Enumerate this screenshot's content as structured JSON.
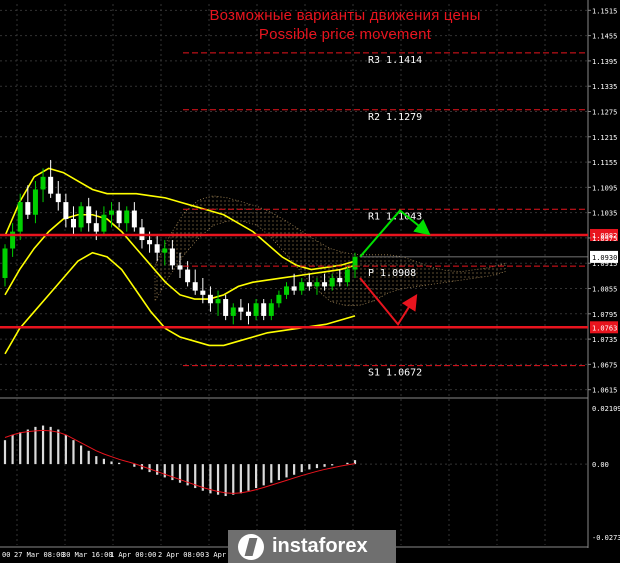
{
  "header": {
    "title_ru": "Возможные варианты движения цены",
    "title_en": "Possible price movement"
  },
  "watermark": {
    "text": "instaforex",
    "icon": "instaforex-logo-icon"
  },
  "colors": {
    "background": "#000000",
    "grid": "#333333",
    "title": "#e8141e",
    "level_line": "#e8141e",
    "bullish_candle": "#00d000",
    "bearish_candle": "#ffffff",
    "bollinger": "#ffff00",
    "ichimoku_cloud": "#c8a46a",
    "forecast_arrow_up": "#00e000",
    "forecast_arrow_down": "#e8141e",
    "macd_histogram": "#dcdcdc",
    "macd_signal": "#e8141e"
  },
  "chart_data": {
    "type": "candlestick",
    "instrument": "EURUSD",
    "price_axis_ticks": [
      "1.1515",
      "1.1455",
      "1.1395",
      "1.1335",
      "1.1275",
      "1.1215",
      "1.1155",
      "1.1095",
      "1.1035",
      "1.0975",
      "1.0915",
      "1.0855",
      "1.0795",
      "1.0735",
      "1.0675",
      "1.0615"
    ],
    "ylim": [
      1.06,
      1.153
    ],
    "time_axis_ticks": [
      "00",
      "27 Mar 08:00",
      "30 Mar 16:00",
      "1 Apr 00:00",
      "2 Apr 08:00",
      "3 Apr"
    ],
    "current_price": "1.0930",
    "levels": [
      {
        "name": "R3",
        "label": "R3 1.1414",
        "value": 1.1414,
        "style": "dashed"
      },
      {
        "name": "R2",
        "label": "R2 1.1279",
        "value": 1.1279,
        "style": "dashed"
      },
      {
        "name": "R1",
        "label": "R1 1.1043",
        "value": 1.1043,
        "style": "dashed"
      },
      {
        "name": "P",
        "label": "P 1.0908",
        "value": 1.0908,
        "style": "dashed"
      },
      {
        "name": "S1",
        "label": "S1 1.0672",
        "value": 1.0672,
        "style": "dashed"
      }
    ],
    "key_lines": [
      {
        "label": "1.0982",
        "value": 1.0982
      },
      {
        "label": "1.0763",
        "value": 1.0763
      }
    ],
    "candles": [
      {
        "o": 1.088,
        "h": 1.096,
        "l": 1.086,
        "c": 1.095
      },
      {
        "o": 1.095,
        "h": 1.101,
        "l": 1.093,
        "c": 1.099
      },
      {
        "o": 1.099,
        "h": 1.108,
        "l": 1.097,
        "c": 1.106
      },
      {
        "o": 1.106,
        "h": 1.11,
        "l": 1.102,
        "c": 1.103
      },
      {
        "o": 1.103,
        "h": 1.111,
        "l": 1.101,
        "c": 1.109
      },
      {
        "o": 1.109,
        "h": 1.114,
        "l": 1.106,
        "c": 1.112
      },
      {
        "o": 1.112,
        "h": 1.116,
        "l": 1.107,
        "c": 1.108
      },
      {
        "o": 1.108,
        "h": 1.111,
        "l": 1.104,
        "c": 1.106
      },
      {
        "o": 1.106,
        "h": 1.108,
        "l": 1.1,
        "c": 1.102
      },
      {
        "o": 1.102,
        "h": 1.105,
        "l": 1.098,
        "c": 1.1
      },
      {
        "o": 1.1,
        "h": 1.106,
        "l": 1.099,
        "c": 1.105
      },
      {
        "o": 1.105,
        "h": 1.107,
        "l": 1.099,
        "c": 1.101
      },
      {
        "o": 1.101,
        "h": 1.104,
        "l": 1.097,
        "c": 1.099
      },
      {
        "o": 1.099,
        "h": 1.105,
        "l": 1.098,
        "c": 1.103
      },
      {
        "o": 1.103,
        "h": 1.106,
        "l": 1.1,
        "c": 1.104
      },
      {
        "o": 1.104,
        "h": 1.106,
        "l": 1.1,
        "c": 1.101
      },
      {
        "o": 1.101,
        "h": 1.105,
        "l": 1.099,
        "c": 1.104
      },
      {
        "o": 1.104,
        "h": 1.106,
        "l": 1.099,
        "c": 1.1
      },
      {
        "o": 1.1,
        "h": 1.102,
        "l": 1.095,
        "c": 1.097
      },
      {
        "o": 1.097,
        "h": 1.099,
        "l": 1.094,
        "c": 1.096
      },
      {
        "o": 1.096,
        "h": 1.098,
        "l": 1.092,
        "c": 1.094
      },
      {
        "o": 1.094,
        "h": 1.097,
        "l": 1.091,
        "c": 1.095
      },
      {
        "o": 1.095,
        "h": 1.097,
        "l": 1.09,
        "c": 1.091
      },
      {
        "o": 1.091,
        "h": 1.094,
        "l": 1.088,
        "c": 1.09
      },
      {
        "o": 1.09,
        "h": 1.092,
        "l": 1.086,
        "c": 1.087
      },
      {
        "o": 1.087,
        "h": 1.09,
        "l": 1.084,
        "c": 1.085
      },
      {
        "o": 1.085,
        "h": 1.088,
        "l": 1.082,
        "c": 1.084
      },
      {
        "o": 1.084,
        "h": 1.086,
        "l": 1.08,
        "c": 1.082
      },
      {
        "o": 1.082,
        "h": 1.085,
        "l": 1.079,
        "c": 1.083
      },
      {
        "o": 1.083,
        "h": 1.084,
        "l": 1.078,
        "c": 1.079
      },
      {
        "o": 1.079,
        "h": 1.082,
        "l": 1.077,
        "c": 1.081
      },
      {
        "o": 1.081,
        "h": 1.083,
        "l": 1.078,
        "c": 1.08
      },
      {
        "o": 1.08,
        "h": 1.082,
        "l": 1.077,
        "c": 1.079
      },
      {
        "o": 1.079,
        "h": 1.083,
        "l": 1.078,
        "c": 1.082
      },
      {
        "o": 1.082,
        "h": 1.083,
        "l": 1.078,
        "c": 1.079
      },
      {
        "o": 1.079,
        "h": 1.083,
        "l": 1.078,
        "c": 1.082
      },
      {
        "o": 1.082,
        "h": 1.085,
        "l": 1.081,
        "c": 1.084
      },
      {
        "o": 1.084,
        "h": 1.087,
        "l": 1.083,
        "c": 1.086
      },
      {
        "o": 1.086,
        "h": 1.089,
        "l": 1.084,
        "c": 1.085
      },
      {
        "o": 1.085,
        "h": 1.088,
        "l": 1.084,
        "c": 1.087
      },
      {
        "o": 1.087,
        "h": 1.089,
        "l": 1.085,
        "c": 1.086
      },
      {
        "o": 1.086,
        "h": 1.088,
        "l": 1.084,
        "c": 1.087
      },
      {
        "o": 1.087,
        "h": 1.089,
        "l": 1.085,
        "c": 1.086
      },
      {
        "o": 1.086,
        "h": 1.089,
        "l": 1.085,
        "c": 1.088
      },
      {
        "o": 1.088,
        "h": 1.09,
        "l": 1.086,
        "c": 1.087
      },
      {
        "o": 1.087,
        "h": 1.091,
        "l": 1.086,
        "c": 1.09
      },
      {
        "o": 1.09,
        "h": 1.094,
        "l": 1.088,
        "c": 1.093
      }
    ],
    "bollinger_upper": [
      1.098,
      1.106,
      1.112,
      1.114,
      1.113,
      1.111,
      1.109,
      1.108,
      1.108,
      1.108,
      1.1075,
      1.107,
      1.106,
      1.105,
      1.104,
      1.103,
      1.101,
      1.099,
      1.096,
      1.093,
      1.091,
      1.09,
      1.0905,
      1.091,
      1.092
    ],
    "bollinger_middle": [
      1.084,
      1.09,
      1.095,
      1.099,
      1.102,
      1.103,
      1.103,
      1.102,
      1.099,
      1.095,
      1.091,
      1.087,
      1.084,
      1.083,
      1.083,
      1.084,
      1.086,
      1.087,
      1.0875,
      1.088,
      1.0885,
      1.089,
      1.0895,
      1.09,
      1.091
    ],
    "bollinger_lower": [
      1.07,
      1.076,
      1.08,
      1.084,
      1.088,
      1.092,
      1.094,
      1.093,
      1.09,
      1.085,
      1.08,
      1.076,
      1.074,
      1.073,
      1.072,
      1.072,
      1.073,
      1.074,
      1.075,
      1.0755,
      1.076,
      1.0765,
      1.077,
      1.078,
      1.079
    ],
    "forecast": [
      {
        "direction": "up",
        "from": 1.093,
        "via": 1.104,
        "to": 1.099
      },
      {
        "direction": "down",
        "from": 1.088,
        "via": 1.077,
        "to": 1.083
      }
    ],
    "macd": {
      "axis_ticks": [
        "0.02109",
        "0.00",
        "-0.02739"
      ],
      "ylim": [
        -0.02739,
        0.02109
      ],
      "histogram": [
        0.009,
        0.011,
        0.012,
        0.013,
        0.014,
        0.0145,
        0.014,
        0.013,
        0.011,
        0.009,
        0.007,
        0.005,
        0.003,
        0.002,
        0.001,
        0.0005,
        0.0,
        -0.001,
        -0.002,
        -0.003,
        -0.004,
        -0.005,
        -0.006,
        -0.007,
        -0.008,
        -0.009,
        -0.01,
        -0.011,
        -0.0115,
        -0.012,
        -0.0115,
        -0.011,
        -0.01,
        -0.009,
        -0.008,
        -0.007,
        -0.006,
        -0.005,
        -0.004,
        -0.003,
        -0.002,
        -0.0015,
        -0.001,
        -0.0005,
        0.0,
        0.0005,
        0.0015
      ],
      "signal": [
        0.01,
        0.011,
        0.0118,
        0.0122,
        0.0125,
        0.0127,
        0.0125,
        0.012,
        0.011,
        0.0095,
        0.008,
        0.0065,
        0.005,
        0.0038,
        0.0028,
        0.0018,
        0.001,
        0.0002,
        -0.0008,
        -0.0018,
        -0.0028,
        -0.0038,
        -0.0048,
        -0.0058,
        -0.0068,
        -0.0078,
        -0.0088,
        -0.0096,
        -0.0103,
        -0.0108,
        -0.011,
        -0.0108,
        -0.0103,
        -0.0096,
        -0.0088,
        -0.0079,
        -0.007,
        -0.0061,
        -0.0052,
        -0.0043,
        -0.0035,
        -0.0027,
        -0.002,
        -0.0014,
        -0.0008,
        -0.0003,
        0.0002
      ]
    }
  }
}
